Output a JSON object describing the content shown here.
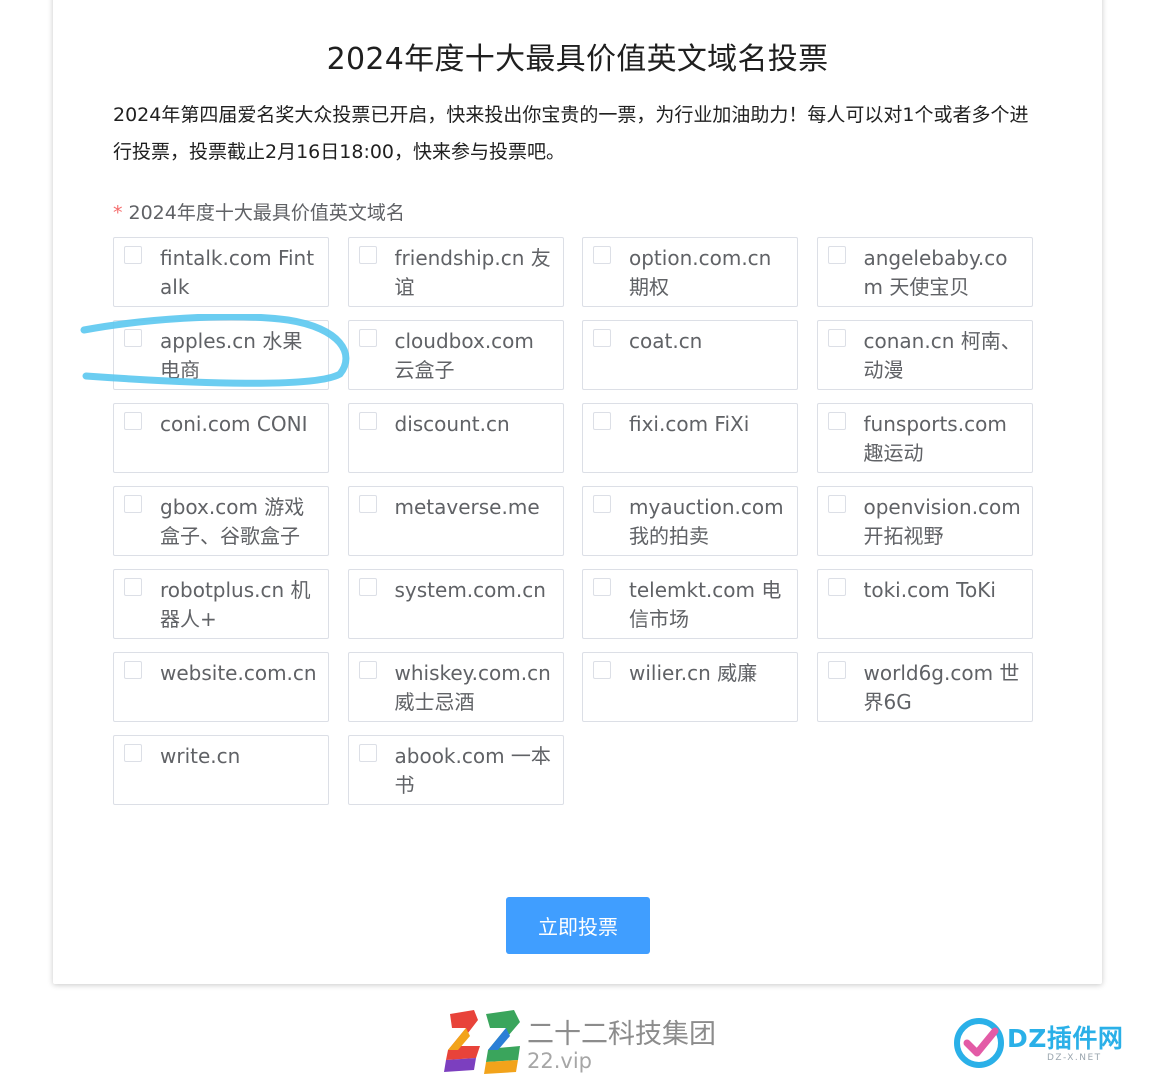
{
  "form": {
    "title": "2024年度十大最具价值英文域名投票",
    "description": "2024年第四届爱名奖大众投票已开启，快来投出你宝贵的一票，为行业加油助力！每人可以对1个或者多个进行投票，投票截止2月16日18:00，快来参与投票吧。",
    "field_label": "2024年度十大最具价值英文域名",
    "required_mark": "*",
    "options": [
      {
        "label": "fintalk.com Fintalk",
        "checked": false
      },
      {
        "label": "friendship.cn 友谊",
        "checked": false
      },
      {
        "label": "option.com.cn 期权",
        "checked": false
      },
      {
        "label": "angelebaby.com 天使宝贝",
        "checked": false
      },
      {
        "label": "apples.cn 水果电商",
        "checked": false
      },
      {
        "label": "cloudbox.com 云盒子",
        "checked": false
      },
      {
        "label": "coat.cn",
        "checked": false
      },
      {
        "label": "conan.cn 柯南、动漫",
        "checked": false
      },
      {
        "label": "coni.com CONI",
        "checked": false
      },
      {
        "label": "discount.cn",
        "checked": false
      },
      {
        "label": "fixi.com FiXi",
        "checked": false
      },
      {
        "label": "funsports.com 趣运动",
        "checked": false
      },
      {
        "label": "gbox.com 游戏盒子、谷歌盒子",
        "checked": false
      },
      {
        "label": "metaverse.me",
        "checked": false
      },
      {
        "label": "myauction.com 我的拍卖",
        "checked": false
      },
      {
        "label": "openvision.com 开拓视野",
        "checked": false
      },
      {
        "label": "robotplus.cn 机器人+",
        "checked": false
      },
      {
        "label": "system.com.cn",
        "checked": false
      },
      {
        "label": "telemkt.com 电信市场",
        "checked": false
      },
      {
        "label": "toki.com ToKi",
        "checked": false
      },
      {
        "label": "website.com.cn",
        "checked": false
      },
      {
        "label": "whiskey.com.cn 威士忌酒",
        "checked": false
      },
      {
        "label": "wilier.cn 威廉",
        "checked": false
      },
      {
        "label": "world6g.com 世界6G",
        "checked": false
      },
      {
        "label": "write.cn",
        "checked": false
      },
      {
        "label": "abook.com 一本书",
        "checked": false
      }
    ],
    "submit_label": "立即投票"
  },
  "footer": {
    "company_name": "二十二科技集团",
    "company_url": "22.vip"
  },
  "watermark": {
    "brand": "DZ插件网",
    "sub": "DZ-X.NET"
  },
  "colors": {
    "primary": "#409eff",
    "required": "#f56c6c",
    "highlight_stroke": "#5bc8f0"
  }
}
